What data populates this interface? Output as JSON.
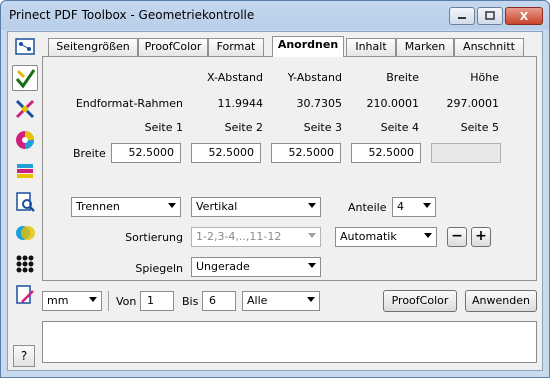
{
  "window": {
    "title": "Prinect PDF Toolbox - Geometriekontrolle",
    "minimize_icon": "minimize-icon",
    "maximize_icon": "maximize-icon",
    "close_label": "X"
  },
  "toolbar": {
    "tools": [
      {
        "name": "sheet-layout-icon",
        "active": false
      },
      {
        "name": "geometry-check-icon",
        "active": true
      },
      {
        "name": "color-separation-icon",
        "active": false
      },
      {
        "name": "color-wheel-icon",
        "active": false
      },
      {
        "name": "color-swatches-icon",
        "active": false
      },
      {
        "name": "preflight-search-icon",
        "active": false
      },
      {
        "name": "overprint-icon",
        "active": false
      },
      {
        "name": "screening-dots-icon",
        "active": false
      },
      {
        "name": "document-pen-icon",
        "active": false
      }
    ],
    "help_label": "?"
  },
  "tabs": [
    {
      "label": "Seitengrößen",
      "active": false
    },
    {
      "label": "ProofColor",
      "active": false
    },
    {
      "label": "Format",
      "active": false
    },
    {
      "label": "Anordnen",
      "active": true
    },
    {
      "label": "Inhalt",
      "active": false
    },
    {
      "label": "Marken",
      "active": false
    },
    {
      "label": "Anschnitt",
      "active": false
    }
  ],
  "anordnen": {
    "headers": {
      "x": "X-Abstand",
      "y": "Y-Abstand",
      "breite": "Breite",
      "hoehe": "Höhe"
    },
    "endformat": {
      "label": "Endformat-Rahmen",
      "x": "11.9944",
      "y": "30.7305",
      "breite": "210.0001",
      "hoehe": "297.0001"
    },
    "pages": [
      "Seite 1",
      "Seite 2",
      "Seite 3",
      "Seite 4",
      "Seite 5"
    ],
    "breite_row": {
      "label": "Breite",
      "values": [
        "52.5000",
        "52.5000",
        "52.5000",
        "52.5000",
        ""
      ]
    },
    "mode_select": "Trennen",
    "direction_select": "Vertikal",
    "anteile": {
      "label": "Anteile",
      "value": "4"
    },
    "sortierung": {
      "label": "Sortierung",
      "value": "1-2,3-4,..,11-12",
      "mode": "Automatik",
      "minus": "−",
      "plus": "+"
    },
    "spiegeln": {
      "label": "Spiegeln",
      "value": "Ungerade"
    }
  },
  "bottom": {
    "unit": "mm",
    "von_label": "Von",
    "von_value": "1",
    "bis_label": "Bis",
    "bis_value": "6",
    "range_select": "Alle",
    "proofcolor_button": "ProofColor",
    "apply_button": "Anwenden"
  },
  "colors": {
    "titlebar": "#b9cfe9",
    "client_bg": "#f0f0f0",
    "close_button": "#c9442b"
  }
}
